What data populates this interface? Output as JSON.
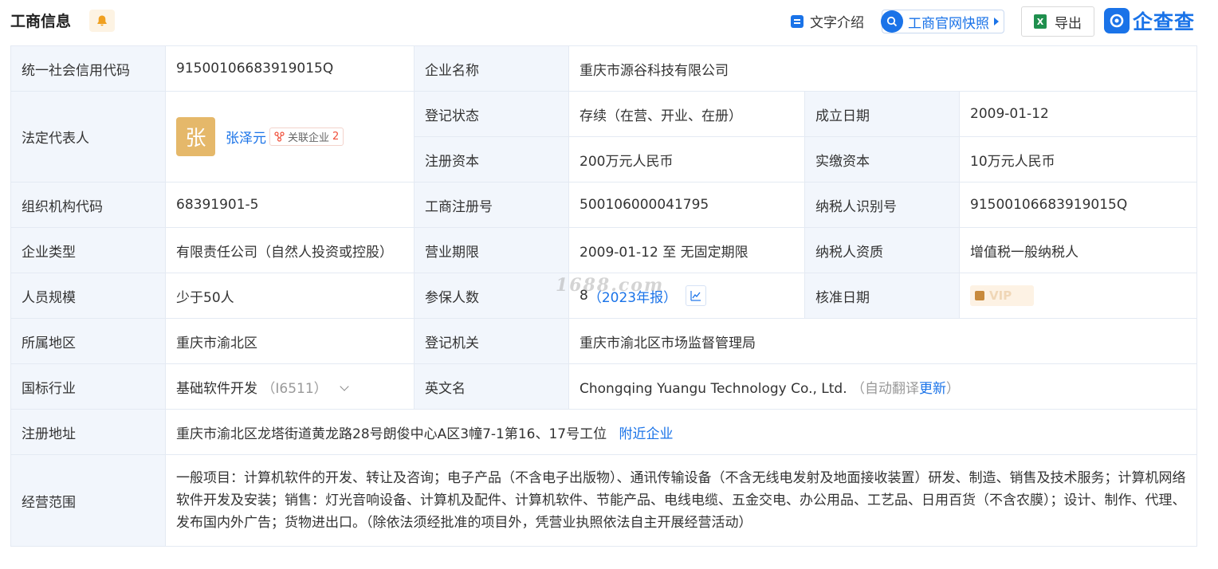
{
  "header": {
    "title": "工商信息",
    "text_intro_label": "文字介绍",
    "snapshot_label": "工商官网快照",
    "export_label": "导出",
    "logo_text": "企查查",
    "bell_icon": "bell-icon",
    "accent_color": "#1a73e8"
  },
  "fields": {
    "credit_code_label": "统一社会信用代码",
    "credit_code": "91500106683919015Q",
    "company_name_label": "企业名称",
    "company_name": "重庆市源谷科技有限公司",
    "legal_rep_label": "法定代表人",
    "legal_rep_avatar": "张",
    "legal_rep_name": "张泽元",
    "related_label": "关联企业",
    "related_count": "2",
    "reg_status_label": "登记状态",
    "reg_status": "存续（在营、开业、在册）",
    "found_date_label": "成立日期",
    "found_date": "2009-01-12",
    "reg_capital_label": "注册资本",
    "reg_capital": "200万元人民币",
    "paid_capital_label": "实缴资本",
    "paid_capital": "10万元人民币",
    "org_code_label": "组织机构代码",
    "org_code": "68391901-5",
    "biz_reg_no_label": "工商注册号",
    "biz_reg_no": "500106000041795",
    "taxpayer_id_label": "纳税人识别号",
    "taxpayer_id": "91500106683919015Q",
    "company_type_label": "企业类型",
    "company_type": "有限责任公司（自然人投资或控股）",
    "biz_term_label": "营业期限",
    "biz_term": "2009-01-12 至 无固定期限",
    "taxpayer_qual_label": "纳税人资质",
    "taxpayer_qual": "增值税一般纳税人",
    "staff_size_label": "人员规模",
    "staff_size": "少于50人",
    "insured_label": "参保人数",
    "insured_count": "8",
    "insured_year": "（2023年报）",
    "approve_date_label": "核准日期",
    "approve_date_vip": "VIP",
    "region_label": "所属地区",
    "region": "重庆市渝北区",
    "reg_authority_label": "登记机关",
    "reg_authority": "重庆市渝北区市场监督管理局",
    "industry_label": "国标行业",
    "industry": "基础软件开发",
    "industry_code": "（I6511）",
    "english_name_label": "英文名",
    "english_name": "Chongqing Yuangu Technology Co., Ltd.",
    "auto_translate": "（自动翻译",
    "update_link": "更新",
    "close_paren": "）",
    "address_label": "注册地址",
    "address": "重庆市渝北区龙塔街道黄龙路28号朗俊中心A区3幢7-1第16、17号工位",
    "nearby_link": "附近企业",
    "scope_label": "经营范围",
    "scope": "一般项目：计算机软件的开发、转让及咨询；电子产品（不含电子出版物）、通讯传输设备（不含无线电发射及地面接收装置）研发、制造、销售及技术服务；计算机网络软件开发及安装；销售：灯光音响设备、计算机及配件、计算机软件、节能产品、电线电缆、五金交电、办公用品、工艺品、日用百货（不含农膜）；设计、制作、代理、发布国内外广告；货物进出口。（除依法须经批准的项目外，凭营业执照依法自主开展经营活动）"
  },
  "watermark": "1688.com"
}
